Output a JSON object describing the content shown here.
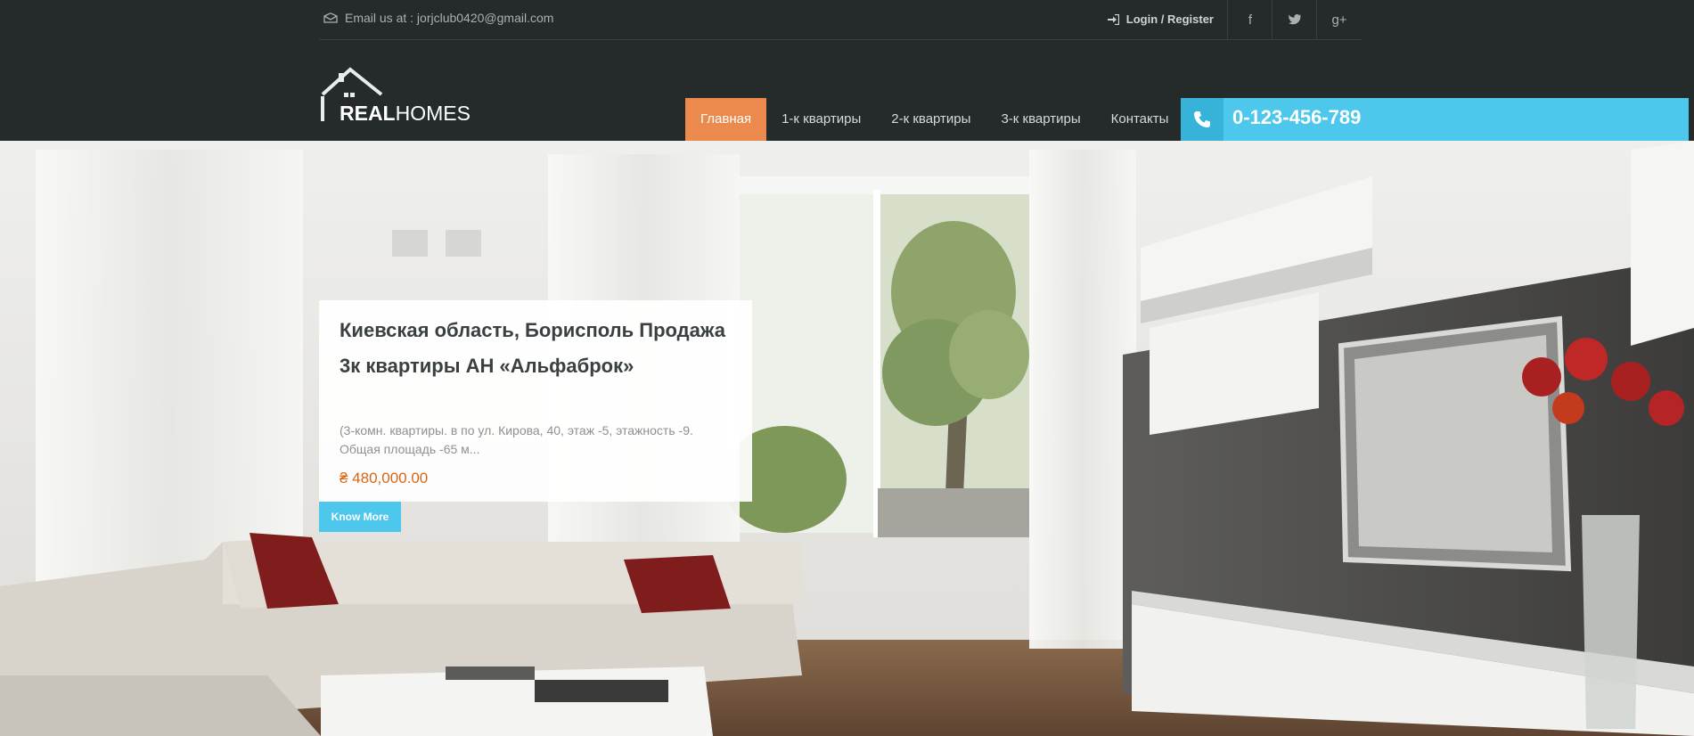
{
  "topbar": {
    "email_text": "Email us at : jorjclub0420@gmail.com",
    "login_text": "Login / Register",
    "social": [
      {
        "icon": "facebook-icon",
        "glyph": "f"
      },
      {
        "icon": "twitter-icon",
        "glyph": "t"
      },
      {
        "icon": "google-plus-icon",
        "glyph": "g+"
      }
    ]
  },
  "logo": {
    "bold": "REAL",
    "light": "HOMES"
  },
  "nav": {
    "items": [
      {
        "label": "Главная",
        "active": true
      },
      {
        "label": "1-к квартиры",
        "active": false
      },
      {
        "label": "2-к квартиры",
        "active": false
      },
      {
        "label": "3-к квартиры",
        "active": false
      },
      {
        "label": "Контакты",
        "active": false
      }
    ]
  },
  "phone": {
    "number": "0-123-456-789"
  },
  "hero": {
    "title": "Киевская область, Борисполь Продажа 3к квартиры АН «Альфаброк»",
    "description": "(3-комн. квартиры. в по ул. Кирова, 40, этаж -5, этажность -9. Общая площадь -65 м...",
    "price": "₴ 480,000.00",
    "button_label": "Know More"
  },
  "colors": {
    "header_bg": "#252a2b",
    "accent_orange": "#ec894d",
    "accent_blue": "#4dc7ec",
    "price_color": "#d56716"
  }
}
